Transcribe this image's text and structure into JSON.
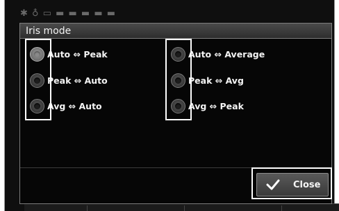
{
  "dialog": {
    "title": "Iris mode",
    "options_left": [
      {
        "label": "Auto ⇔ Peak",
        "selected": true
      },
      {
        "label": "Peak ⇔ Auto",
        "selected": false
      },
      {
        "label": "Avg ⇔ Auto",
        "selected": false
      }
    ],
    "options_right": [
      {
        "label": "Auto ⇔ Average",
        "selected": false
      },
      {
        "label": "Peak ⇔ Avg",
        "selected": false
      },
      {
        "label": "Avg ⇔ Peak",
        "selected": false
      }
    ],
    "close_label": "Close",
    "close_icon": "check-icon"
  },
  "colors": {
    "background": "#0f0f0f",
    "title_bar": "#3a3a3a",
    "highlight_frame": "#ffffff"
  }
}
